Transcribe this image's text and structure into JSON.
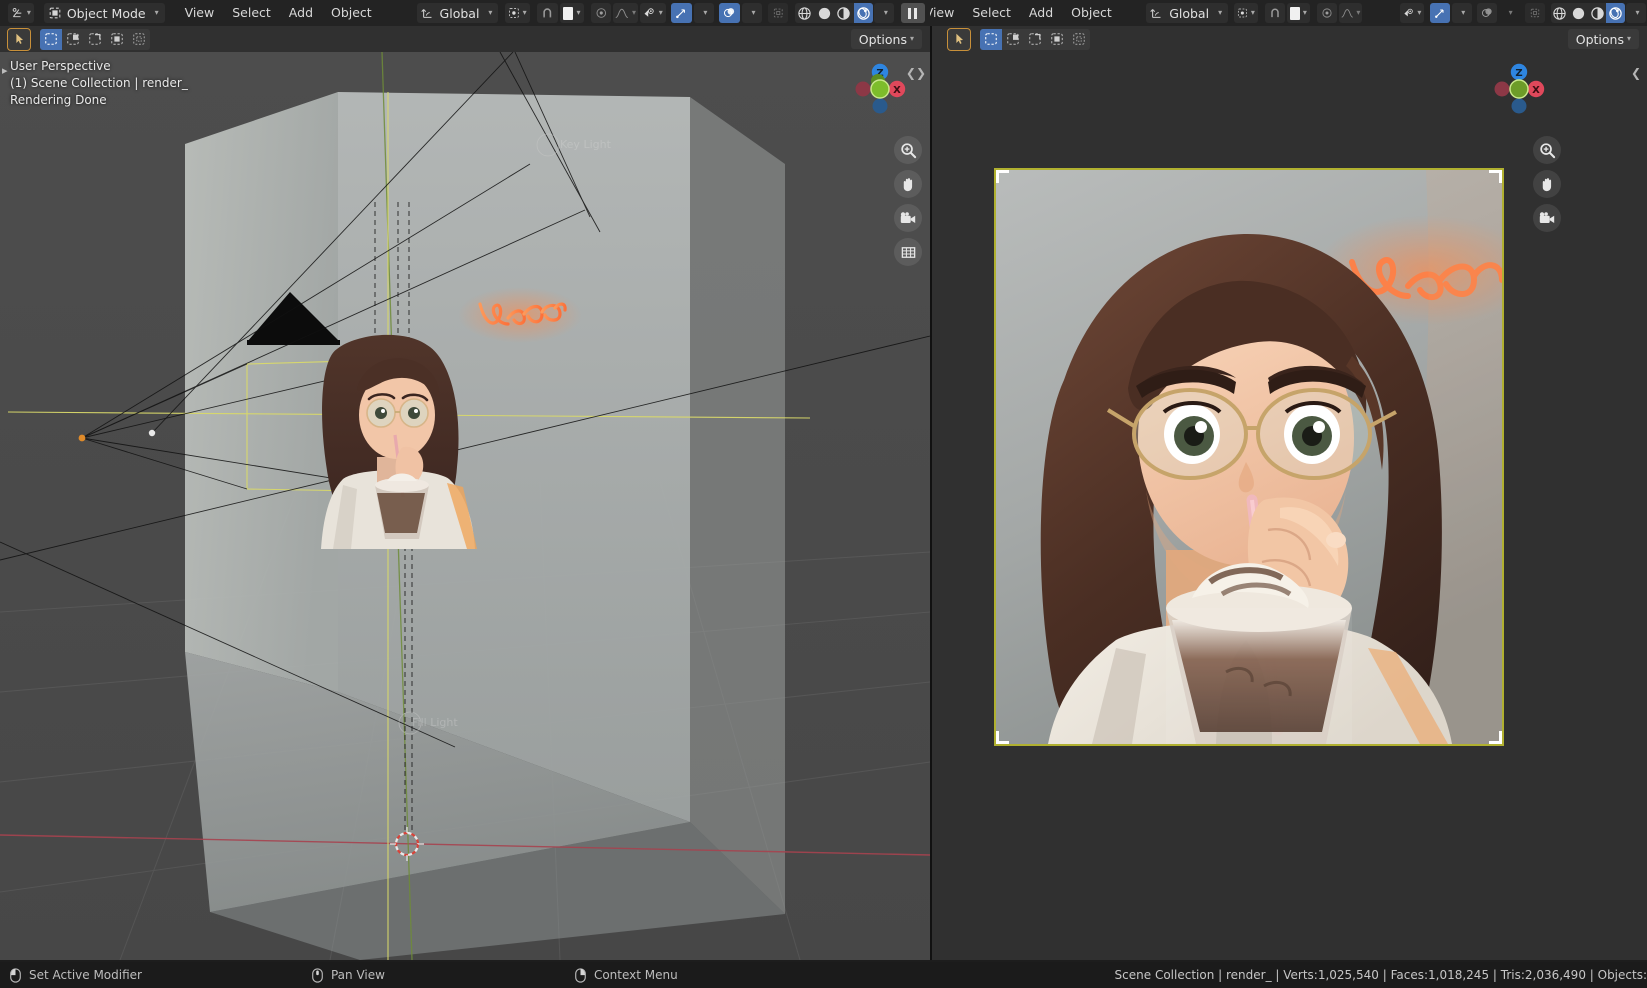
{
  "app": {
    "name": "Blender",
    "theme_bg": "#1d1d1d"
  },
  "topbar": {
    "left": {
      "editor_type_icon": "editor-type-icon",
      "mode": "Object Mode",
      "menus": [
        "View",
        "Select",
        "Add",
        "Object"
      ],
      "transform_orientation": "Global",
      "snap_icon": "snap-magnet-icon",
      "proportional_icon": "proportional-edit-icon",
      "falloff_icon": "falloff-curve-icon",
      "visibility_icon": "object-types-visibility-icon",
      "gizmo_icon": "gizmo-icon",
      "overlays_icon": "overlays-icon",
      "xray_icon": "xray-toggle-icon",
      "shading_modes": [
        "wireframe",
        "solid",
        "material-preview",
        "rendered"
      ],
      "active_shading": "rendered",
      "pause_label": "pause-render-button"
    },
    "right": {
      "menus": [
        "View",
        "Select",
        "Add",
        "Object"
      ],
      "transform_orientation": "Global",
      "shading_modes": [
        "wireframe",
        "solid",
        "material-preview",
        "rendered"
      ],
      "active_shading": "rendered"
    }
  },
  "tool_header": {
    "left": {
      "active_tool": "tweak-select-tool",
      "select_modes": [
        "set",
        "extend",
        "subtract",
        "invert",
        "intersect"
      ],
      "active_select_mode": "set",
      "options_label": "Options"
    },
    "right": {
      "active_tool": "tweak-select-tool",
      "select_modes": [
        "set",
        "extend",
        "subtract",
        "invert",
        "intersect"
      ],
      "active_select_mode": "set",
      "options_label": "Options"
    }
  },
  "viewport_left": {
    "info_lines": [
      "User Perspective",
      "(1) Scene Collection | render_",
      "Rendering Done"
    ],
    "gizmo_axes": [
      {
        "label": "Z",
        "color": "#2e85e0"
      },
      {
        "label": "Y",
        "color": "#7dbd2b"
      },
      {
        "label": "X",
        "color": "#e0485b"
      }
    ],
    "nav_tools": [
      "zoom-icon",
      "pan-hand-icon",
      "camera-view-icon",
      "toggle-ortho-icon"
    ],
    "scene_labels": [
      "Key Light",
      "Fill Light"
    ]
  },
  "viewport_right": {
    "gizmo_axes": [
      {
        "label": "Z",
        "color": "#2e85e0"
      },
      {
        "label": "Y",
        "color": "#7dbd2b"
      },
      {
        "label": "X",
        "color": "#e0485b"
      }
    ],
    "nav_tools": [
      "zoom-icon",
      "pan-hand-icon",
      "camera-view-icon"
    ],
    "render_border_color": "#b0b030"
  },
  "statusbar": {
    "hints": [
      {
        "mouse": "left-mouse-icon",
        "label": "Set Active Modifier"
      },
      {
        "mouse": "middle-mouse-icon",
        "label": "Pan View"
      },
      {
        "mouse": "right-mouse-icon",
        "label": "Context Menu"
      }
    ],
    "stats": "Scene Collection | render_ | Verts:1,025,540 | Faces:1,018,245 | Tris:2,036,490 | Objects:"
  }
}
